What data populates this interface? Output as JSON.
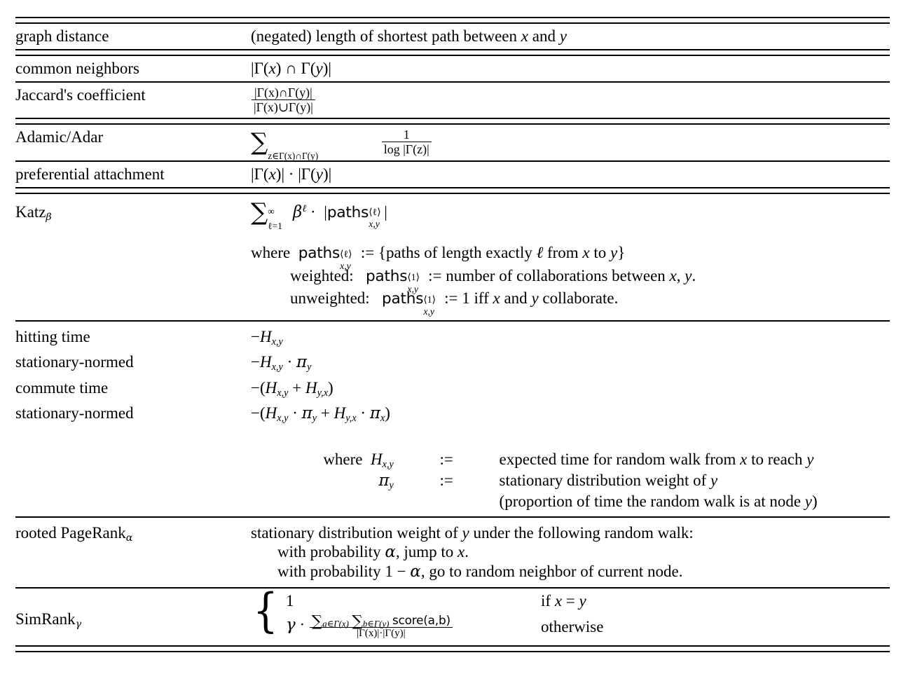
{
  "table": {
    "caption": "",
    "rows": [
      {
        "id": "graph-distance",
        "label": "graph distance",
        "formula_text": "(negated) length of shortest path between x and y"
      },
      {
        "id": "common-neighbors",
        "label": "common neighbors",
        "formula_text": "|Γ(x) ∩ Γ(y)|"
      },
      {
        "id": "jaccards-coefficient",
        "label": "Jaccard's coefficient",
        "formula_numerator": "|Γ(x)∩Γ(y)|",
        "formula_denominator": "|Γ(x)∪Γ(y)|"
      },
      {
        "id": "adamic-adar",
        "label": "Adamic/Adar",
        "sum_symbol": "∑",
        "sum_sub": "z∈Γ(x)∩Γ(y)",
        "frac_num": "1",
        "frac_den": "log |Γ(z)|"
      },
      {
        "id": "preferential-attachment",
        "label": "preferential attachment",
        "formula_text": "|Γ(x)| · |Γ(y)|"
      },
      {
        "id": "katz",
        "label_main": "Katz",
        "label_sub": "β",
        "sum_symbol": "∑",
        "sum_lower": "ℓ=1",
        "sum_upper": "∞",
        "beta_term": "β",
        "beta_exp": "ℓ",
        "dot": "·",
        "paths_word": "paths",
        "paths_sup": "⟨ℓ⟩",
        "paths_sub": "x,y",
        "where_line1_pre": "where",
        "where_line1_post": ":= {paths of length exactly ℓ from x to y}",
        "where_line2_pre": "weighted:",
        "where_line2_sup": "⟨1⟩",
        "where_line2_post": ":= number of collaborations between x, y.",
        "where_line3_pre": "unweighted:",
        "where_line3_sup": "⟨1⟩",
        "where_line3_post": ":= 1 iff x and y collaborate."
      },
      {
        "id": "hitting-time",
        "label": "hitting time",
        "formula_text": "−H",
        "formula_sub": "x,y"
      },
      {
        "id": "hitting-time-stationary-normed",
        "label": "stationary-normed",
        "indented": true,
        "formula_text": "−H",
        "formula_sub": "x,y",
        "formula_tail": " · π",
        "formula_tail_sub": "y"
      },
      {
        "id": "commute-time",
        "label": "commute time",
        "formula_text": "−(H",
        "formula_sub": "x,y",
        "formula_mid": " + H",
        "formula_mid_sub": "y,x",
        "formula_end": ")"
      },
      {
        "id": "commute-time-stationary-normed",
        "label": "stationary-normed",
        "indented": true,
        "formula_text": "−(H",
        "formula_sub": "x,y",
        "formula_mid": " · π",
        "formula_mid_sub": "y",
        "formula_mid2": " + H",
        "formula_mid2_sub": "y,x",
        "formula_mid3": " · π",
        "formula_mid3_sub": "x",
        "formula_end": ")"
      },
      {
        "id": "hitting-where",
        "where_label": "where",
        "def1_lhs": "H",
        "def1_lhs_sub": "x,y",
        "def1_rel": ":=",
        "def1_rhs": "expected time for random walk from x to reach y",
        "def2_lhs": "π",
        "def2_lhs_sub": "y",
        "def2_rel": ":=",
        "def2_rhs": "stationary distribution weight of y",
        "def3_rhs": "(proportion of time the random walk is at node y)"
      },
      {
        "id": "rooted-pagerank",
        "label_main": "rooted PageRank",
        "label_sub": "α",
        "line1": "stationary distribution weight of y under the following random walk:",
        "line2": "with probability α, jump to x.",
        "line3": "with probability 1 − α, go to random neighbor of current node."
      },
      {
        "id": "simrank",
        "label_main": "SimRank",
        "label_sub": "γ",
        "case1_value": "1",
        "case1_cond": "if x = y",
        "case2_gamma": "γ",
        "case2_dot": "·",
        "case2_num_sum1": "∑",
        "case2_num_sum1_sub": "a∈Γ(x)",
        "case2_num_sum2": "∑",
        "case2_num_sum2_sub": "b∈Γ(y)",
        "case2_num_score": "score(a,b)",
        "case2_den": "|Γ(x)|·|Γ(y)|",
        "case2_cond": "otherwise"
      }
    ]
  },
  "symbols": {
    "x": "x",
    "y": "y",
    "gamma_cap": "Γ",
    "intersect": "∩",
    "union": "∪",
    "cdot": "·",
    "infty": "∞",
    "ell": "ℓ",
    "pi": "π",
    "alpha": "α",
    "beta": "β",
    "gamma": "γ",
    "minus": "−",
    "assign": ":="
  },
  "colors": {
    "rule": "#000000",
    "text": "#000000",
    "background": "#ffffff"
  }
}
